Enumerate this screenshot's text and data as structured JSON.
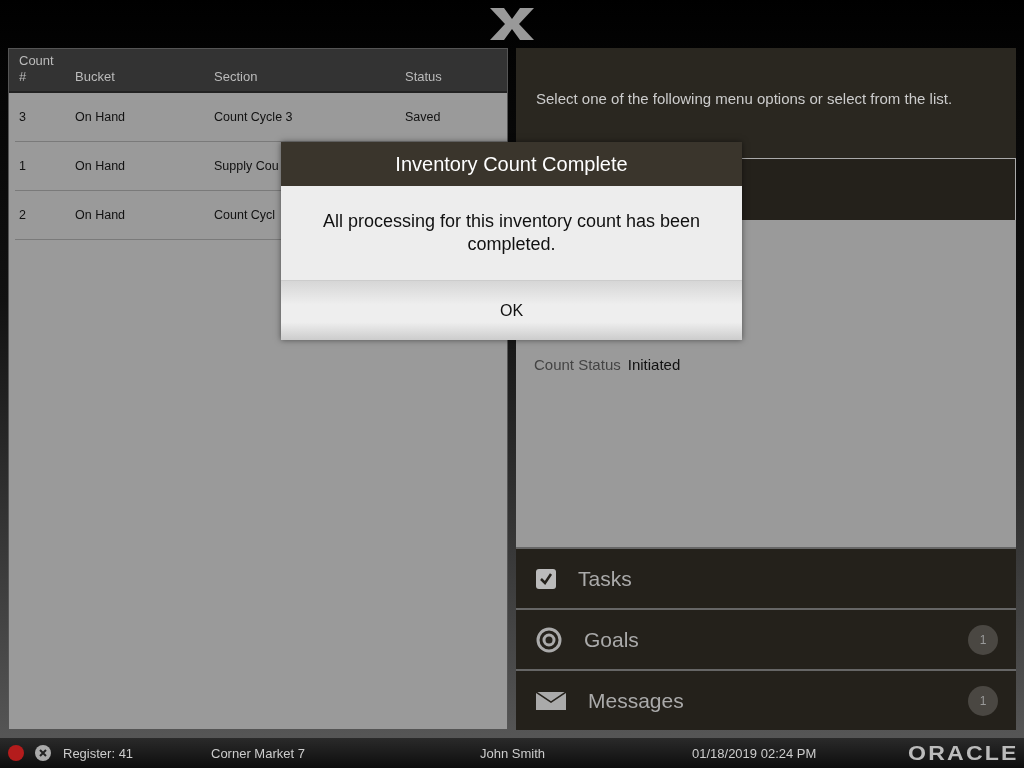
{
  "table": {
    "columns": [
      {
        "label": "Count\n#"
      },
      {
        "label": "Bucket"
      },
      {
        "label": "Section"
      },
      {
        "label": "Status"
      }
    ],
    "rows": [
      {
        "cells": [
          "3",
          "On Hand",
          "Count Cycle 3",
          "Saved"
        ]
      },
      {
        "cells": [
          "1",
          "On Hand",
          "Supply Cou"
        ]
      },
      {
        "cells": [
          "2",
          "On Hand",
          "Count Cycl"
        ]
      }
    ]
  },
  "instructions": "Select one of the following menu options or select from the list.",
  "details": [
    {
      "label": "Count Status",
      "value": "Initiated"
    }
  ],
  "menu": [
    {
      "kind": "tasks",
      "label": "Tasks"
    },
    {
      "kind": "goals",
      "label": "Goals",
      "badge": "1"
    },
    {
      "kind": "messages",
      "label": "Messages",
      "badge": "1"
    }
  ],
  "dialog": {
    "title": "Inventory Count Complete",
    "message": "All processing for this inventory count has been completed.",
    "button": "OK"
  },
  "status_bar": {
    "register": "Register: 41",
    "store": "Corner Market 7",
    "user": "John Smith",
    "datetime": "01/18/2019 02:24 PM",
    "logo": "ORACLE"
  }
}
